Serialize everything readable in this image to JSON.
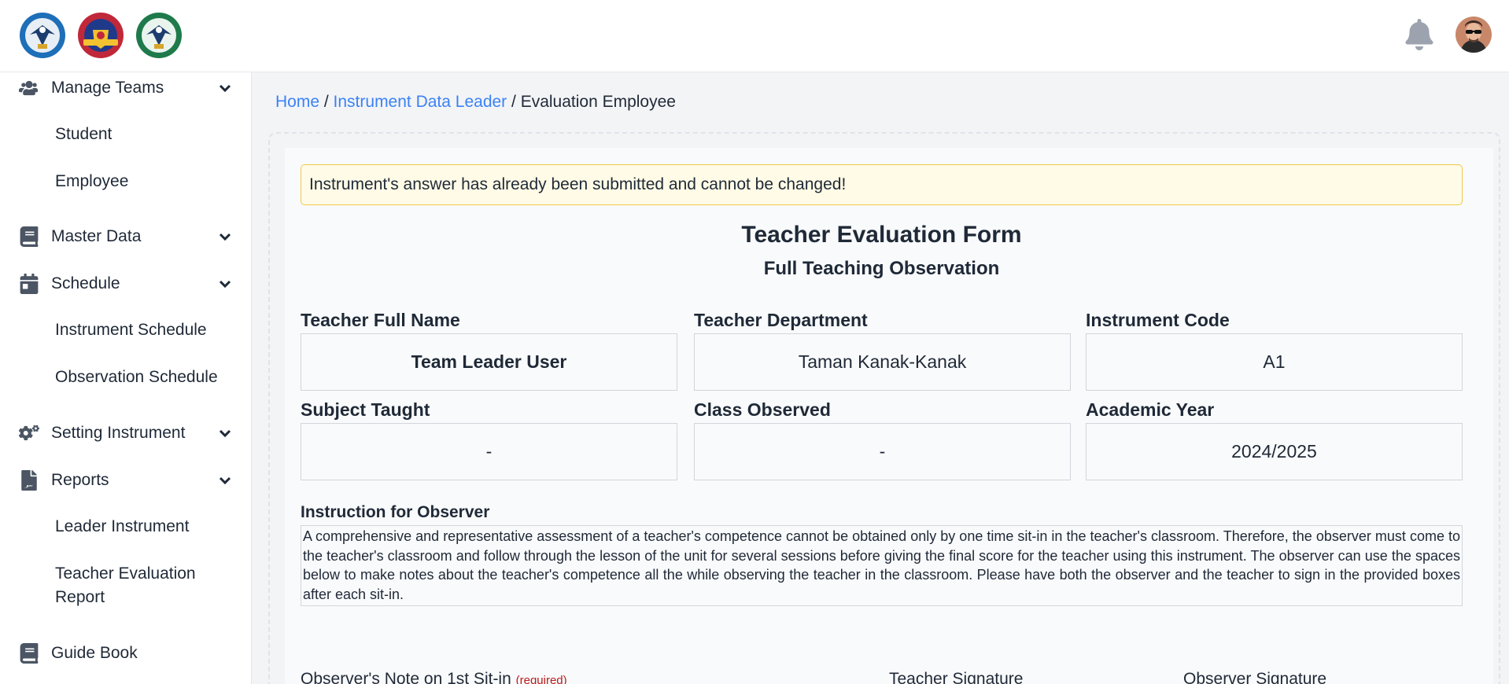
{
  "header": {
    "logos": [
      "logo-1",
      "logo-2",
      "logo-3"
    ],
    "notification_icon": "bell-icon",
    "avatar": "user-avatar"
  },
  "sidebar": {
    "items": [
      {
        "label": "Manage Teams",
        "icon": "users-icon",
        "expanded": true
      },
      {
        "label": "Student"
      },
      {
        "label": "Employee"
      },
      {
        "label": "Master Data",
        "icon": "book-icon"
      },
      {
        "label": "Schedule",
        "icon": "calendar-icon",
        "expanded": true
      },
      {
        "label": "Instrument Schedule"
      },
      {
        "label": "Observation Schedule"
      },
      {
        "label": "Setting Instrument",
        "icon": "gears-icon"
      },
      {
        "label": "Reports",
        "icon": "file-signature-icon",
        "expanded": true
      },
      {
        "label": "Leader Instrument"
      },
      {
        "label": "Teacher Evaluation",
        "label2": "Report"
      },
      {
        "label": "Guide Book",
        "icon": "book-icon"
      }
    ]
  },
  "breadcrumb": {
    "home": "Home",
    "sep": " / ",
    "section": "Instrument Data Leader",
    "current": "Evaluation Employee"
  },
  "alert": "Instrument's answer has already been submitted and cannot be changed!",
  "form": {
    "title": "Teacher Evaluation Form",
    "subtitle": "Full Teaching Observation",
    "fields": [
      {
        "label": "Teacher Full Name",
        "value": "Team Leader User"
      },
      {
        "label": "Teacher Department",
        "value": "Taman Kanak-Kanak"
      },
      {
        "label": "Instrument Code",
        "value": "A1"
      },
      {
        "label": "Subject Taught",
        "value": "-"
      },
      {
        "label": "Class Observed",
        "value": "-"
      },
      {
        "label": "Academic Year",
        "value": "2024/2025"
      }
    ],
    "instruction_label": "Instruction for Observer",
    "instruction_text": "A comprehensive and representative assessment of a teacher's competence cannot be obtained only by one time sit-in in the teacher's classroom. Therefore, the observer must come to the teacher's classroom and follow through the lesson of the unit for several sessions before giving the final score for the teacher using this instrument. The observer can use the spaces below to make notes about the teacher's competence all the while observing the teacher in the classroom. Please have both the observer and the teacher to sign in the provided boxes after each sit-in.",
    "note_label": "Observer's Note on 1st Sit-in",
    "required": "(required)",
    "teacher_signature": "Teacher Signature",
    "observer_signature": "Observer Signature"
  },
  "colors": {
    "link": "#3b82f6",
    "alert_bg": "#fffbe6",
    "alert_border": "#f1c94a",
    "required": "#b91c1c"
  }
}
